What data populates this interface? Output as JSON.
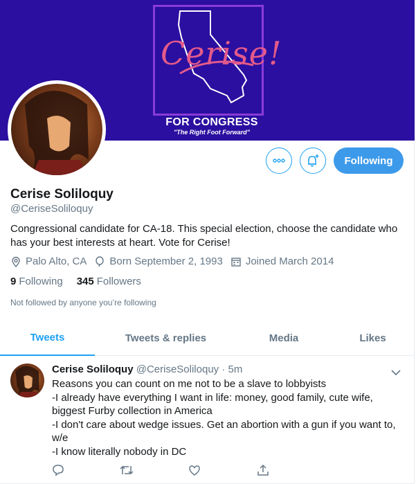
{
  "banner": {
    "logo_word": "Cerise!",
    "title": "FOR CONGRESS",
    "tagline": "\"The Right Foot Forward\"",
    "colors": {
      "background": "#2a0fa0",
      "logo_border": "#8a3bd9",
      "logo_word": "#e35a8a"
    }
  },
  "actions": {
    "more_icon": "more-dots-icon",
    "notify_icon": "bell-plus-icon",
    "following_label": "Following"
  },
  "profile": {
    "name": "Cerise Soliloquy",
    "handle": "@CeriseSoliloquy",
    "bio": "Congressional candidate for CA-18. This special election, choose the candidate who has your best interests at heart. Vote for Cerise!",
    "location": "Palo Alto, CA",
    "born": "Born September 2, 1993",
    "joined": "Joined March 2014",
    "following_count": "9",
    "following_label": "Following",
    "followers_count": "345",
    "followers_label": "Followers",
    "not_followed": "Not followed by anyone you’re following"
  },
  "tabs": [
    {
      "label": "Tweets",
      "active": true
    },
    {
      "label": "Tweets & replies",
      "active": false
    },
    {
      "label": "Media",
      "active": false
    },
    {
      "label": "Likes",
      "active": false
    }
  ],
  "tweet": {
    "name": "Cerise Soliloquy",
    "handle": "@CeriseSoliloquy",
    "separator": " · ",
    "time": "5m",
    "lines": [
      "Reasons you can count on me not to be a slave to lobbyists",
      "-I already have everything I want in life: money, good family, cute wife, biggest Furby collection in America",
      "-I don't care about wedge issues. Get an abortion with a gun if you want to, w/e",
      "-I know literally nobody in DC"
    ],
    "action_icons": [
      "reply-icon",
      "retweet-icon",
      "like-icon",
      "share-icon"
    ]
  },
  "colors": {
    "accent": "#1da1f2",
    "following_button": "#3d9aea",
    "muted": "#657786"
  }
}
